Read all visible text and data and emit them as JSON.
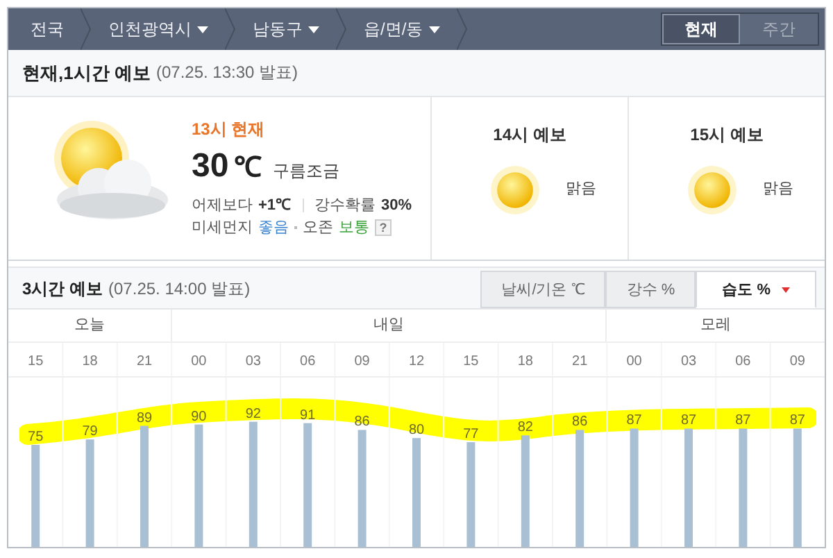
{
  "nav": {
    "breadcrumbs": [
      {
        "label": "전국",
        "dropdown": false
      },
      {
        "label": "인천광역시",
        "dropdown": true
      },
      {
        "label": "남동구",
        "dropdown": true
      },
      {
        "label": "읍/면/동",
        "dropdown": true
      }
    ],
    "tabs": [
      {
        "label": "현재",
        "selected": true
      },
      {
        "label": "주간",
        "selected": false
      }
    ]
  },
  "current_section": {
    "title": "현재,1시간 예보",
    "issued": "(07.25. 13:30 발표)",
    "now": {
      "kind": "sun-cloud",
      "time": "13시 현재",
      "temp": "30",
      "unit": "℃",
      "condition": "구름조금",
      "compare_label": "어제보다",
      "compare_value": "+1℃",
      "rain_label": "강수확률",
      "rain_value": "30%",
      "dust_label": "미세먼지",
      "dust_value": "좋음",
      "ozone_label": "오존",
      "ozone_value": "보통",
      "help": "?"
    },
    "forecasts": [
      {
        "title": "14시 예보",
        "kind": "sun",
        "condition": "맑음"
      },
      {
        "title": "15시 예보",
        "kind": "sun",
        "condition": "맑음"
      }
    ]
  },
  "three_hour_section": {
    "title": "3시간 예보",
    "issued": "(07.25. 14:00 발표)",
    "tabs": [
      {
        "label": "날씨/기온 ℃",
        "selected": false
      },
      {
        "label": "강수 %",
        "selected": false
      },
      {
        "label": "습도 %",
        "selected": true
      }
    ],
    "days": [
      "오늘",
      "내일",
      "모레"
    ],
    "chart_data": {
      "type": "bar",
      "categories": [
        "15",
        "18",
        "21",
        "00",
        "03",
        "06",
        "09",
        "12",
        "15",
        "18",
        "21",
        "00",
        "03",
        "06",
        "09"
      ],
      "series": [
        {
          "color": "#a9c0d4",
          "values": [
            75,
            79,
            89,
            90,
            92,
            91,
            86,
            80,
            77,
            82,
            86,
            87,
            87,
            87,
            87
          ]
        }
      ],
      "data_labels": true
    },
    "highlight": {
      "color": "#ffff00"
    }
  }
}
